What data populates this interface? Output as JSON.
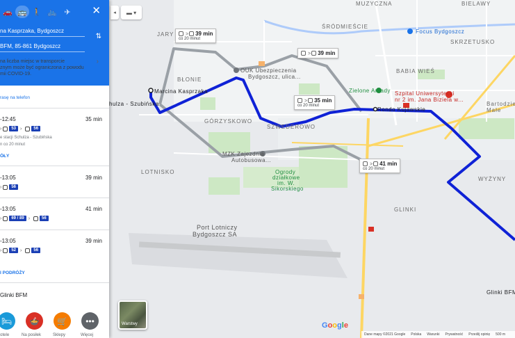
{
  "panel": {
    "origin": "na Kasprzaka, Bydgoszcz",
    "destination": "BFM, 85-861 Bydgoszcz",
    "notice_lines": [
      "na liczba miejsc w transporcie",
      "znym może być ograniczona z powodu",
      "mii COVID-19."
    ],
    "send_link": "rasę na telefon",
    "options": [
      {
        "time": "-12:45",
        "duration": "35 min",
        "segments": [
          "53",
          "56"
        ],
        "meta": [
          "e stacji Schulza - Szubińska",
          "n  co 20 minut"
        ],
        "link": "ÓŁY"
      },
      {
        "time": "-13:05",
        "duration": "39 min",
        "segments": [
          "56"
        ],
        "meta": [],
        "link": ""
      },
      {
        "time": "-13:05",
        "duration": "41 min",
        "segments": [
          "69 / 89",
          "56"
        ],
        "meta": [],
        "link": ""
      },
      {
        "time": "-13:05",
        "duration": "39 min",
        "segments": [
          "52",
          "56"
        ],
        "meta": [],
        "link": ""
      }
    ],
    "trip_link": "I PODRÓŻY",
    "dest_name": "Glinki BFM",
    "actions": [
      {
        "label": "hotele",
        "color": "#1a9ad9",
        "icon": "bed-icon"
      },
      {
        "label": "Na posiłek",
        "color": "#d93025",
        "icon": "restaurant-icon"
      },
      {
        "label": "Sklepy",
        "color": "#f57c00",
        "icon": "cart-icon"
      },
      {
        "label": "Więcej",
        "color": "#5f6368",
        "icon": "more-icon"
      }
    ]
  },
  "map": {
    "labels": [
      {
        "text": "MUZYCZNA",
        "cls": "district"
      },
      {
        "text": "BIELAWY",
        "cls": "district"
      },
      {
        "text": "JARY",
        "cls": "district"
      },
      {
        "text": "ŚRÓDMIEŚCIE",
        "cls": "district"
      },
      {
        "text": "SKRZETUSKO",
        "cls": "district"
      },
      {
        "text": "BŁONIE",
        "cls": "district"
      },
      {
        "text": "BABIA WIEŚ",
        "cls": "district"
      },
      {
        "text": "GÓRZYSKOWO",
        "cls": "district"
      },
      {
        "text": "SZWEDEROWO",
        "cls": "district"
      },
      {
        "text": "LOTNISKO",
        "cls": "district"
      },
      {
        "text": "GLINKI",
        "cls": "district"
      },
      {
        "text": "WYŻYNY",
        "cls": "district"
      },
      {
        "text": "Bartodzieje Małe",
        "cls": "district"
      },
      {
        "text": "Focus Bydgoszcz",
        "cls": "poi blue"
      },
      {
        "text": "Zielone Arkady",
        "cls": "poi green"
      },
      {
        "text": "Szpital Uniwersytecki",
        "cls": "poi red"
      },
      {
        "text": "nr 2 im. Jana Biziela w...",
        "cls": "poi red"
      },
      {
        "text": "OUK Ubezpieczenia",
        "cls": "poi"
      },
      {
        "text": "Bydgoszcz, ulica...",
        "cls": "poi"
      },
      {
        "text": "MZK Zajezdnia",
        "cls": "poi"
      },
      {
        "text": "Autobusowa...",
        "cls": "poi"
      },
      {
        "text": "Ogrody",
        "cls": "poi green"
      },
      {
        "text": "działkowe",
        "cls": "poi green"
      },
      {
        "text": "im. W.",
        "cls": "poi green"
      },
      {
        "text": "Sikorskiego",
        "cls": "poi green"
      },
      {
        "text": "Port Lotniczy",
        "cls": "poi"
      },
      {
        "text": "Bydgoszcz SA",
        "cls": "poi"
      },
      {
        "text": "Marcina Kasprzaka",
        "cls": "poi"
      },
      {
        "text": "hulza - Szubińska",
        "cls": "poi"
      },
      {
        "text": "Rondo Kujawskie",
        "cls": "poi"
      },
      {
        "text": "Glinki BFM",
        "cls": "poi"
      }
    ],
    "route_boxes": [
      {
        "duration": "39 min",
        "freq": "co 20 minut"
      },
      {
        "duration": "39 min",
        "freq": ""
      },
      {
        "duration": "35 min",
        "freq": "co 20 minut"
      },
      {
        "duration": "41 min",
        "freq": "co 20 minut"
      }
    ],
    "layers_label": "Warstwy",
    "google_logo": "Google",
    "attribution": [
      "Dane mapy ©2021 Google",
      "Polska",
      "Warunki",
      "Prywatność",
      "Prześlij opinię",
      "500 m"
    ]
  }
}
